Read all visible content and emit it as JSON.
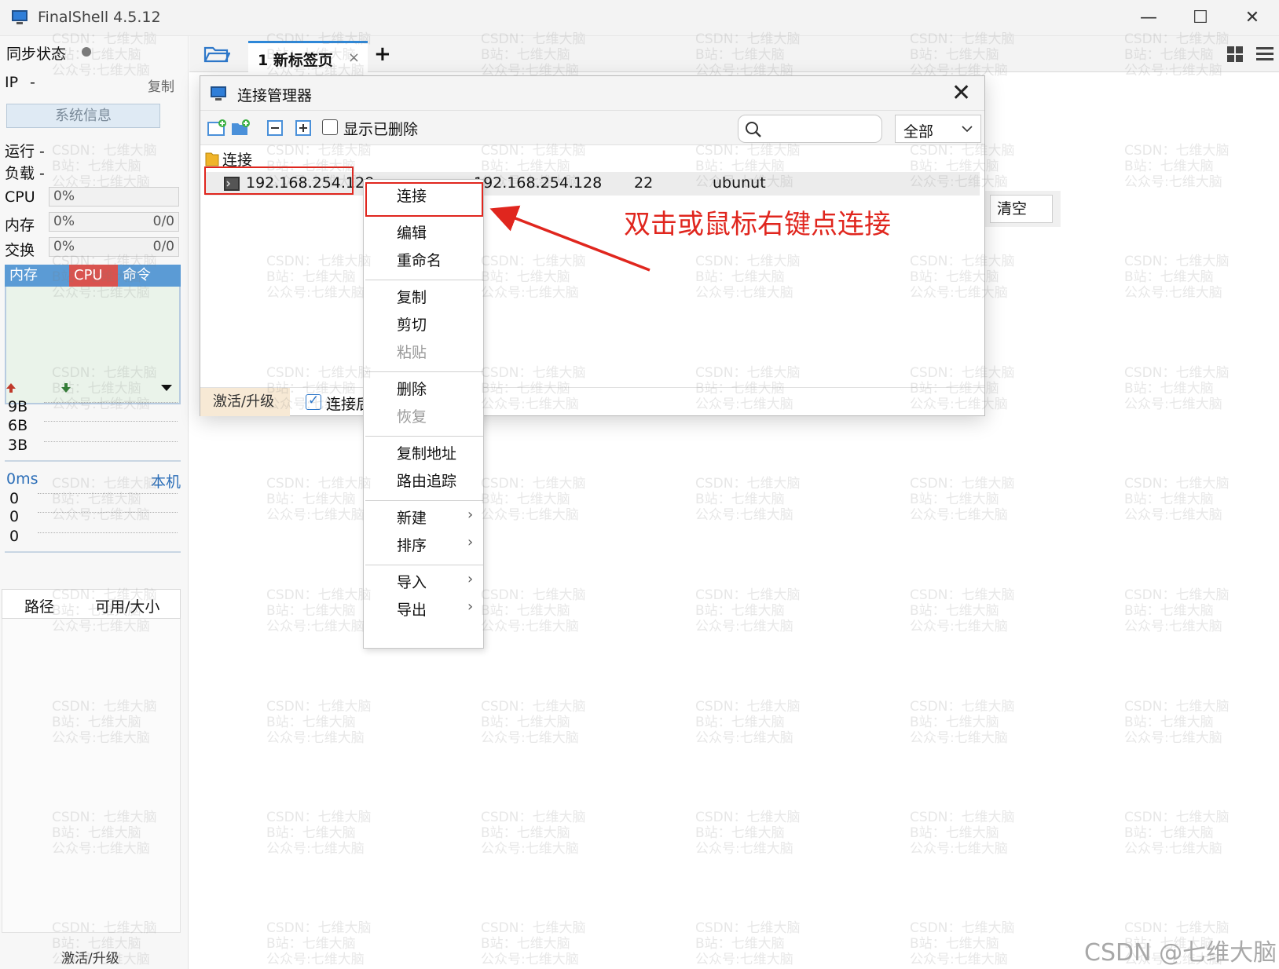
{
  "app": {
    "title": "FinalShell 4.5.12"
  },
  "window_controls": {
    "minimize": "—",
    "maximize": "☐",
    "close": "✕"
  },
  "sidebar": {
    "sync_label": "同步状态",
    "ip_label": "IP",
    "ip_value": "-",
    "copy_label": "复制",
    "sysinfo_button": "系统信息",
    "run_label": "运行 -",
    "load_label": "负载 -",
    "cpu_label": "CPU",
    "cpu_value": "0%",
    "mem_label": "内存",
    "mem_value": "0%",
    "mem_ratio": "0/0",
    "swap_label": "交换",
    "swap_value": "0%",
    "swap_ratio": "0/0",
    "monitor_tabs": [
      "内存",
      "CPU",
      "命令"
    ],
    "net_ticks": [
      "9B",
      "6B",
      "3B"
    ],
    "latency": "0ms",
    "local_label": "本机",
    "latency_rows": [
      "0",
      "0",
      "0"
    ],
    "disk_headers": [
      "路径",
      "可用/大小"
    ],
    "upgrade_label": "激活/升级"
  },
  "tabs": {
    "new_tab": "1 新标签页",
    "close": "×",
    "add": "+"
  },
  "dialog": {
    "title": "连接管理器",
    "close": "✕",
    "show_deleted": "显示已删除",
    "filter_value": "全部",
    "tree_root": "连接",
    "connection": {
      "name": "192.168.254.128",
      "host": "192.168.254.128",
      "port": "22",
      "user": "ubunut"
    },
    "bottom_upgrade": "激活/升级",
    "bottom_checkbox": "连接后"
  },
  "clear_button": "清空",
  "context_menu": {
    "groups": [
      [
        {
          "label": "连接",
          "enabled": true
        }
      ],
      [
        {
          "label": "编辑",
          "enabled": true
        },
        {
          "label": "重命名",
          "enabled": true
        }
      ],
      [
        {
          "label": "复制",
          "enabled": true
        },
        {
          "label": "剪切",
          "enabled": true
        },
        {
          "label": "粘贴",
          "enabled": false
        }
      ],
      [
        {
          "label": "删除",
          "enabled": true
        },
        {
          "label": "恢复",
          "enabled": false
        }
      ],
      [
        {
          "label": "复制地址",
          "enabled": true
        },
        {
          "label": "路由追踪",
          "enabled": true
        }
      ],
      [
        {
          "label": "新建",
          "enabled": true,
          "submenu": true
        },
        {
          "label": "排序",
          "enabled": true,
          "submenu": true
        }
      ],
      [
        {
          "label": "导入",
          "enabled": true,
          "submenu": true
        },
        {
          "label": "导出",
          "enabled": true,
          "submenu": true
        }
      ]
    ]
  },
  "annotation": {
    "text": "双击或鼠标右键点连接",
    "color": "#e0261e"
  },
  "watermark": {
    "lines": [
      "CSDN：七维大脑",
      "B站：七维大脑",
      "公众号:七维大脑"
    ],
    "corner": "CSDN @七维大脑"
  },
  "colors": {
    "accent": "#2d87d8",
    "tab_mem": "#5b9bd5",
    "tab_cpu": "#d9534f",
    "tab_cmd": "#5b9bd5"
  }
}
